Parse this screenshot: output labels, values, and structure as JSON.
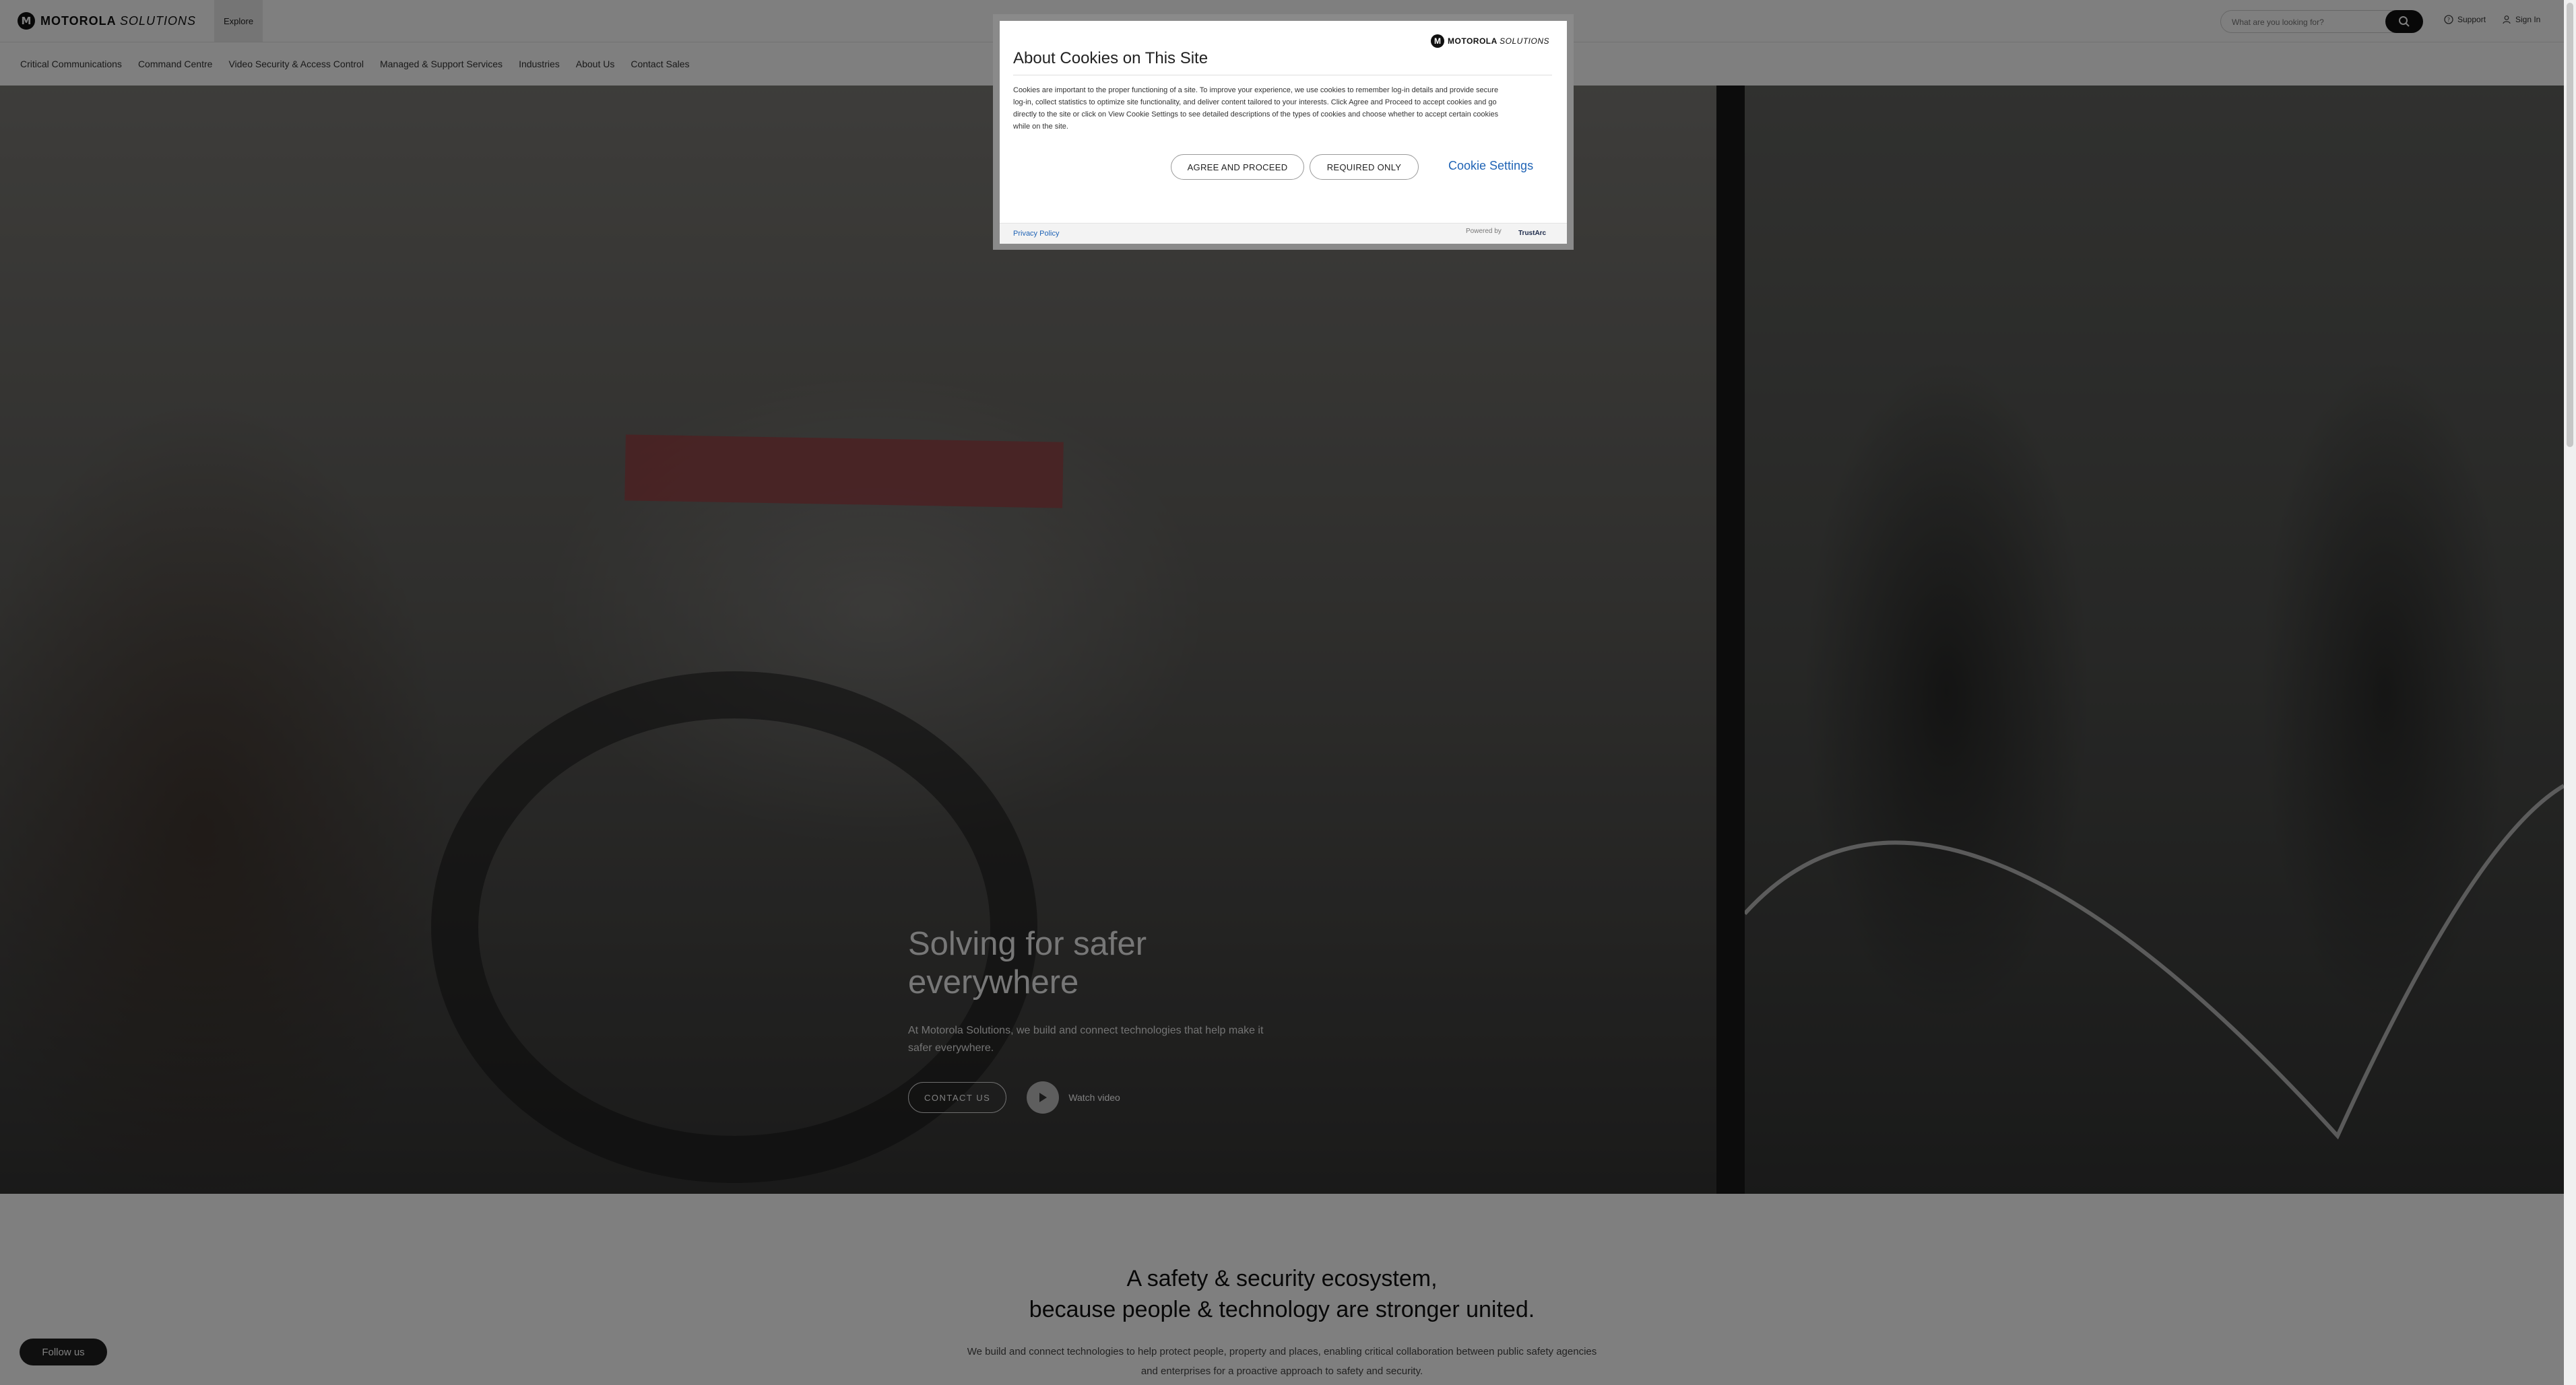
{
  "header": {
    "brand_bold": "MOTOROLA",
    "brand_light": "SOLUTIONS",
    "explore_label": "Explore",
    "search_placeholder": "What are you looking for?",
    "support_label": "Support",
    "signin_label": "Sign In"
  },
  "nav": {
    "items": [
      "Critical Communications",
      "Command Centre",
      "Video Security & Access Control",
      "Managed & Support Services",
      "Industries",
      "About Us",
      "Contact Sales"
    ]
  },
  "hero": {
    "title_line1": "Solving for safer",
    "title_line2": "everywhere",
    "subtitle": "At Motorola Solutions, we build and connect technologies that help make it safer everywhere.",
    "contact_label": "CONTACT US",
    "watch_label": "Watch video"
  },
  "ecosystem": {
    "title_line1": "A safety & security ecosystem,",
    "title_line2": "because people & technology are stronger united.",
    "text_line1": "We build and connect technologies to help protect people, property and places, enabling critical collaboration between public safety agencies",
    "text_line2": "and enterprises for a proactive approach to safety and security."
  },
  "follow_label": "Follow us",
  "cookie_modal": {
    "title": "About Cookies on This Site",
    "logo_bold": "MOTOROLA",
    "logo_light": "SOLUTIONS",
    "body_line1": "Cookies are important to the proper functioning of a site. To improve your experience, we use cookies to remember log-in details and provide secure",
    "body_line2": "log-in, collect statistics to optimize site functionality, and deliver content tailored to your interests. Click Agree and Proceed to accept cookies and go",
    "body_line3": "directly to the site or click on View Cookie Settings to see detailed descriptions of the types of cookies and choose whether to accept certain cookies",
    "body_line4": "while on the site.",
    "agree_label": "AGREE AND PROCEED",
    "required_label": "REQUIRED ONLY",
    "settings_label": "Cookie Settings",
    "privacy_label": "Privacy Policy",
    "powered_label": "Powered by",
    "trustarc_label": "TrustArc"
  }
}
